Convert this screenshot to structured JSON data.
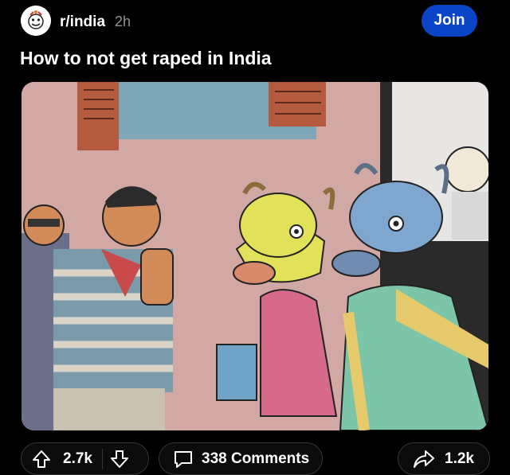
{
  "post": {
    "subreddit": "r/india",
    "time": "2h",
    "join_label": "Join",
    "title": "How to not get raped in India"
  },
  "actions": {
    "upvotes": "2.7k",
    "comments": "338 Comments",
    "shares": "1.2k"
  },
  "icons": {
    "upvote": "upvote-arrow-icon",
    "downvote": "downvote-arrow-icon",
    "comment": "comment-bubble-icon",
    "share": "share-arrow-icon"
  },
  "colors": {
    "join_button": "#0a45c7",
    "background": "#000000",
    "muted_text": "#8e9499"
  }
}
